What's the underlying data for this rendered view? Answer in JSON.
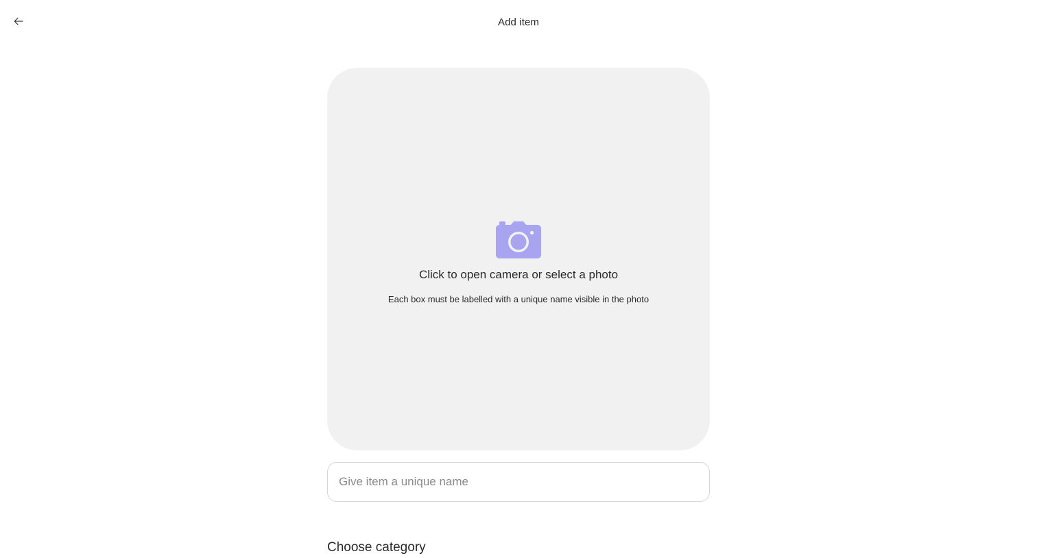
{
  "header": {
    "back_icon": "arrow-left-icon",
    "title": "Add item"
  },
  "photo_upload": {
    "icon": "camera-icon",
    "icon_color": "#a9a4f0",
    "title": "Click to open camera or select a photo",
    "hint": "Each box must be labelled with a unique name visible in the photo"
  },
  "name_field": {
    "placeholder": "Give item a unique name",
    "value": ""
  },
  "category": {
    "title": "Choose category"
  }
}
